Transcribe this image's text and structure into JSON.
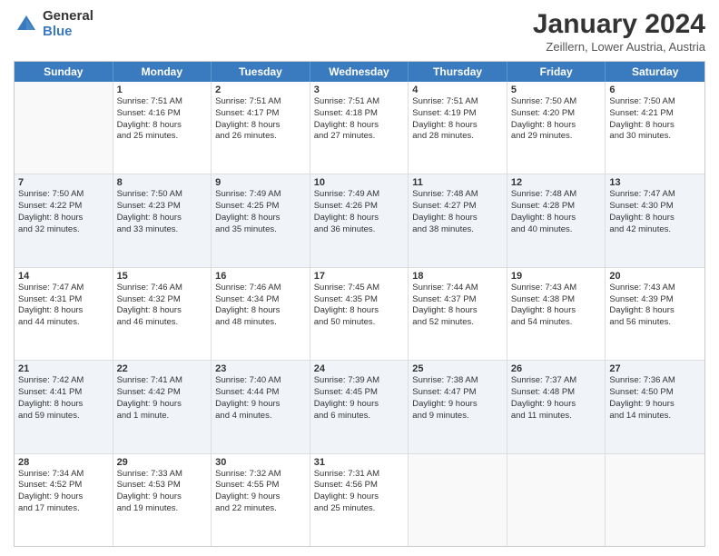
{
  "header": {
    "logo_general": "General",
    "logo_blue": "Blue",
    "month_title": "January 2024",
    "location": "Zeillern, Lower Austria, Austria"
  },
  "weekdays": [
    "Sunday",
    "Monday",
    "Tuesday",
    "Wednesday",
    "Thursday",
    "Friday",
    "Saturday"
  ],
  "rows": [
    {
      "alt": false,
      "cells": [
        {
          "day": "",
          "lines": []
        },
        {
          "day": "1",
          "lines": [
            "Sunrise: 7:51 AM",
            "Sunset: 4:16 PM",
            "Daylight: 8 hours",
            "and 25 minutes."
          ]
        },
        {
          "day": "2",
          "lines": [
            "Sunrise: 7:51 AM",
            "Sunset: 4:17 PM",
            "Daylight: 8 hours",
            "and 26 minutes."
          ]
        },
        {
          "day": "3",
          "lines": [
            "Sunrise: 7:51 AM",
            "Sunset: 4:18 PM",
            "Daylight: 8 hours",
            "and 27 minutes."
          ]
        },
        {
          "day": "4",
          "lines": [
            "Sunrise: 7:51 AM",
            "Sunset: 4:19 PM",
            "Daylight: 8 hours",
            "and 28 minutes."
          ]
        },
        {
          "day": "5",
          "lines": [
            "Sunrise: 7:50 AM",
            "Sunset: 4:20 PM",
            "Daylight: 8 hours",
            "and 29 minutes."
          ]
        },
        {
          "day": "6",
          "lines": [
            "Sunrise: 7:50 AM",
            "Sunset: 4:21 PM",
            "Daylight: 8 hours",
            "and 30 minutes."
          ]
        }
      ]
    },
    {
      "alt": true,
      "cells": [
        {
          "day": "7",
          "lines": [
            "Sunrise: 7:50 AM",
            "Sunset: 4:22 PM",
            "Daylight: 8 hours",
            "and 32 minutes."
          ]
        },
        {
          "day": "8",
          "lines": [
            "Sunrise: 7:50 AM",
            "Sunset: 4:23 PM",
            "Daylight: 8 hours",
            "and 33 minutes."
          ]
        },
        {
          "day": "9",
          "lines": [
            "Sunrise: 7:49 AM",
            "Sunset: 4:25 PM",
            "Daylight: 8 hours",
            "and 35 minutes."
          ]
        },
        {
          "day": "10",
          "lines": [
            "Sunrise: 7:49 AM",
            "Sunset: 4:26 PM",
            "Daylight: 8 hours",
            "and 36 minutes."
          ]
        },
        {
          "day": "11",
          "lines": [
            "Sunrise: 7:48 AM",
            "Sunset: 4:27 PM",
            "Daylight: 8 hours",
            "and 38 minutes."
          ]
        },
        {
          "day": "12",
          "lines": [
            "Sunrise: 7:48 AM",
            "Sunset: 4:28 PM",
            "Daylight: 8 hours",
            "and 40 minutes."
          ]
        },
        {
          "day": "13",
          "lines": [
            "Sunrise: 7:47 AM",
            "Sunset: 4:30 PM",
            "Daylight: 8 hours",
            "and 42 minutes."
          ]
        }
      ]
    },
    {
      "alt": false,
      "cells": [
        {
          "day": "14",
          "lines": [
            "Sunrise: 7:47 AM",
            "Sunset: 4:31 PM",
            "Daylight: 8 hours",
            "and 44 minutes."
          ]
        },
        {
          "day": "15",
          "lines": [
            "Sunrise: 7:46 AM",
            "Sunset: 4:32 PM",
            "Daylight: 8 hours",
            "and 46 minutes."
          ]
        },
        {
          "day": "16",
          "lines": [
            "Sunrise: 7:46 AM",
            "Sunset: 4:34 PM",
            "Daylight: 8 hours",
            "and 48 minutes."
          ]
        },
        {
          "day": "17",
          "lines": [
            "Sunrise: 7:45 AM",
            "Sunset: 4:35 PM",
            "Daylight: 8 hours",
            "and 50 minutes."
          ]
        },
        {
          "day": "18",
          "lines": [
            "Sunrise: 7:44 AM",
            "Sunset: 4:37 PM",
            "Daylight: 8 hours",
            "and 52 minutes."
          ]
        },
        {
          "day": "19",
          "lines": [
            "Sunrise: 7:43 AM",
            "Sunset: 4:38 PM",
            "Daylight: 8 hours",
            "and 54 minutes."
          ]
        },
        {
          "day": "20",
          "lines": [
            "Sunrise: 7:43 AM",
            "Sunset: 4:39 PM",
            "Daylight: 8 hours",
            "and 56 minutes."
          ]
        }
      ]
    },
    {
      "alt": true,
      "cells": [
        {
          "day": "21",
          "lines": [
            "Sunrise: 7:42 AM",
            "Sunset: 4:41 PM",
            "Daylight: 8 hours",
            "and 59 minutes."
          ]
        },
        {
          "day": "22",
          "lines": [
            "Sunrise: 7:41 AM",
            "Sunset: 4:42 PM",
            "Daylight: 9 hours",
            "and 1 minute."
          ]
        },
        {
          "day": "23",
          "lines": [
            "Sunrise: 7:40 AM",
            "Sunset: 4:44 PM",
            "Daylight: 9 hours",
            "and 4 minutes."
          ]
        },
        {
          "day": "24",
          "lines": [
            "Sunrise: 7:39 AM",
            "Sunset: 4:45 PM",
            "Daylight: 9 hours",
            "and 6 minutes."
          ]
        },
        {
          "day": "25",
          "lines": [
            "Sunrise: 7:38 AM",
            "Sunset: 4:47 PM",
            "Daylight: 9 hours",
            "and 9 minutes."
          ]
        },
        {
          "day": "26",
          "lines": [
            "Sunrise: 7:37 AM",
            "Sunset: 4:48 PM",
            "Daylight: 9 hours",
            "and 11 minutes."
          ]
        },
        {
          "day": "27",
          "lines": [
            "Sunrise: 7:36 AM",
            "Sunset: 4:50 PM",
            "Daylight: 9 hours",
            "and 14 minutes."
          ]
        }
      ]
    },
    {
      "alt": false,
      "cells": [
        {
          "day": "28",
          "lines": [
            "Sunrise: 7:34 AM",
            "Sunset: 4:52 PM",
            "Daylight: 9 hours",
            "and 17 minutes."
          ]
        },
        {
          "day": "29",
          "lines": [
            "Sunrise: 7:33 AM",
            "Sunset: 4:53 PM",
            "Daylight: 9 hours",
            "and 19 minutes."
          ]
        },
        {
          "day": "30",
          "lines": [
            "Sunrise: 7:32 AM",
            "Sunset: 4:55 PM",
            "Daylight: 9 hours",
            "and 22 minutes."
          ]
        },
        {
          "day": "31",
          "lines": [
            "Sunrise: 7:31 AM",
            "Sunset: 4:56 PM",
            "Daylight: 9 hours",
            "and 25 minutes."
          ]
        },
        {
          "day": "",
          "lines": []
        },
        {
          "day": "",
          "lines": []
        },
        {
          "day": "",
          "lines": []
        }
      ]
    }
  ]
}
